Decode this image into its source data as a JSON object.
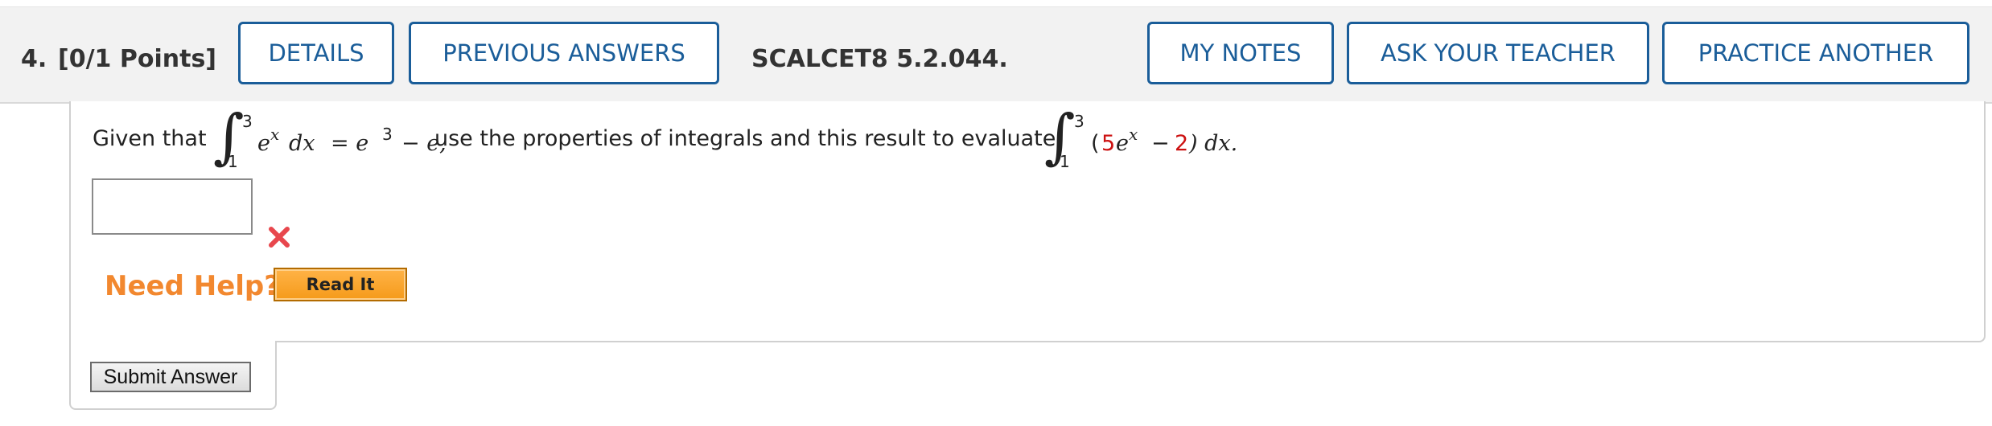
{
  "header": {
    "question_number": "4.",
    "points": "[0/1 Points]",
    "buttons": {
      "details": "DETAILS",
      "previous_answers": "PREVIOUS ANSWERS",
      "my_notes": "MY NOTES",
      "ask_teacher": "ASK YOUR TEACHER",
      "practice_another": "PRACTICE ANOTHER"
    },
    "problem_code": "SCALCET8 5.2.044."
  },
  "question": {
    "given_that": "Given that",
    "integral_symbol": "∫",
    "lower_limit": "1",
    "upper_limit": "3",
    "integrand_e": "e",
    "integrand_exp": "x",
    "dx": "dx",
    "equals_e": "= e",
    "equals_exp": "3",
    "minus_e": "− e,",
    "instruction": "use the properties of integrals and this result to evaluate",
    "second_lower_limit": "1",
    "second_upper_limit": "3",
    "open_paren": "(",
    "coef_5": "5",
    "second_e": "e",
    "second_exp": "x",
    "minus": "−",
    "coef_2": "2",
    "close_paren_dx": ") dx."
  },
  "answer": {
    "value": ""
  },
  "help": {
    "label": "Need Help?",
    "read_it": "Read It"
  },
  "submit_label": "Submit Answer",
  "colors": {
    "accent": "#1a5d99",
    "error_icon": "#e8474d",
    "help_text": "#f2882f",
    "highlight_number": "#cc1111"
  },
  "icons": {
    "incorrect": "close-icon"
  }
}
